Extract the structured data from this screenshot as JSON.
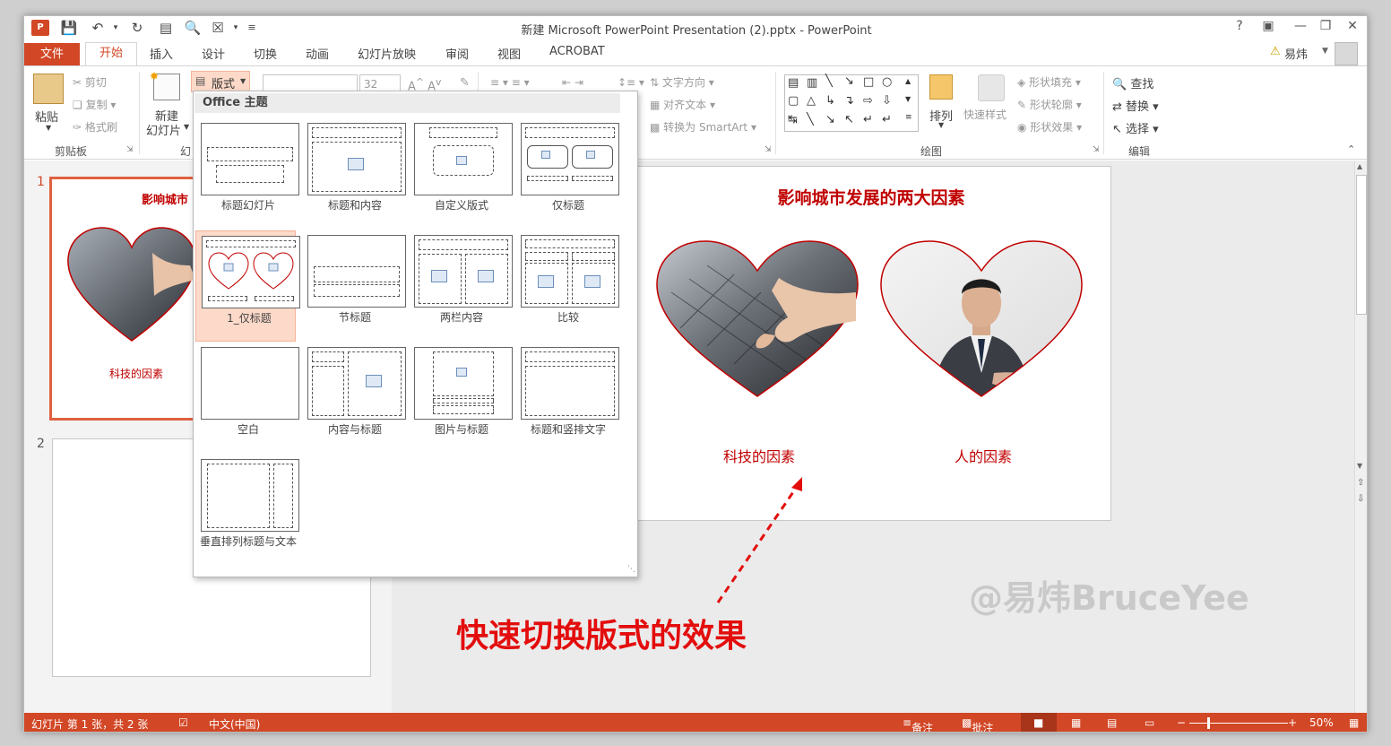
{
  "window": {
    "title": "新建 Microsoft PowerPoint Presentation (2).pptx - PowerPoint",
    "help": "?",
    "user": "易炜"
  },
  "tabs": [
    "文件",
    "开始",
    "插入",
    "设计",
    "切换",
    "动画",
    "幻灯片放映",
    "审阅",
    "视图",
    "ACROBAT"
  ],
  "ribbon": {
    "clipboard": {
      "paste": "粘贴",
      "cut": "剪切",
      "copy": "复制",
      "format_painter": "格式刷",
      "label": "剪贴板"
    },
    "slides": {
      "new_slide_1": "新建",
      "new_slide_2": "幻灯片",
      "layout": "版式",
      "label_fragment": "幻"
    },
    "font": {
      "size": "32"
    },
    "paragraph": {
      "text_direction": "文字方向",
      "align_text": "对齐文本",
      "smartart": "转换为 SmartArt"
    },
    "drawing": {
      "arrange": "排列",
      "quick_styles": "快速样式",
      "fill": "形状填充",
      "outline": "形状轮廓",
      "effects": "形状效果",
      "label": "绘图"
    },
    "editing": {
      "find": "查找",
      "replace": "替换",
      "select": "选择",
      "label": "编辑"
    }
  },
  "layout_menu": {
    "header": "Office 主题",
    "items": [
      "标题幻灯片",
      "标题和内容",
      "自定义版式",
      "仅标题",
      "1_仅标题",
      "节标题",
      "两栏内容",
      "比较",
      "空白",
      "内容与标题",
      "图片与标题",
      "标题和竖排文字",
      "垂直排列标题与文本"
    ],
    "selected": "1_仅标题"
  },
  "thumbnails": [
    {
      "number": "1",
      "title": "影响城市",
      "caption": "科技的因素"
    },
    {
      "number": "2"
    }
  ],
  "slide": {
    "title": "影响城市发展的两大因素",
    "caption_left": "科技的因素",
    "caption_right": "人的因素"
  },
  "annotation": "快速切换版式的效果",
  "watermark": "@易炜BruceYee",
  "status": {
    "slide_info": "幻灯片 第 1 张，共 2 张",
    "language": "中文(中国)",
    "notes": "备注",
    "comments": "批注",
    "zoom": "50%"
  },
  "colors": {
    "accent": "#d24726",
    "slide_red": "#c00000",
    "annotation_red": "#e30d0d"
  }
}
